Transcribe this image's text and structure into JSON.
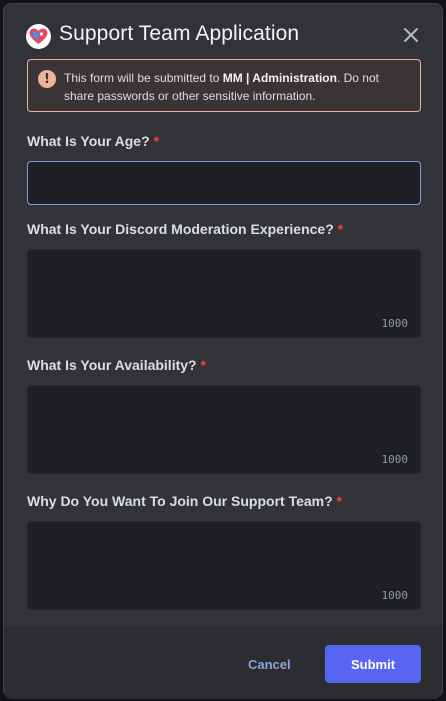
{
  "modal": {
    "title": "Support Team Application",
    "app_icon": "heart-logo-icon",
    "close_icon": "close-icon"
  },
  "warning": {
    "icon": "exclamation-icon",
    "text_before": "This form will be submitted to ",
    "server_name": "MM | Administration",
    "text_after": ". Do not share passwords or other sensitive information."
  },
  "fields": [
    {
      "label": "What Is Your Age?",
      "required_mark": "*",
      "value": ""
    },
    {
      "label": "What Is Your Discord Moderation Experience?",
      "required_mark": "*",
      "value": "",
      "counter": "1000"
    },
    {
      "label": "What Is Your Availability?",
      "required_mark": "*",
      "value": "",
      "counter": "1000"
    },
    {
      "label": "Why Do You Want To Join Our Support Team?",
      "required_mark": "*",
      "value": "",
      "counter": "1000"
    }
  ],
  "footer": {
    "cancel_label": "Cancel",
    "submit_label": "Submit"
  },
  "colors": {
    "accent": "#5865f2",
    "required": "#f23f43",
    "warning_border": "#f0b29a",
    "focus_border": "#7a9bd6"
  }
}
